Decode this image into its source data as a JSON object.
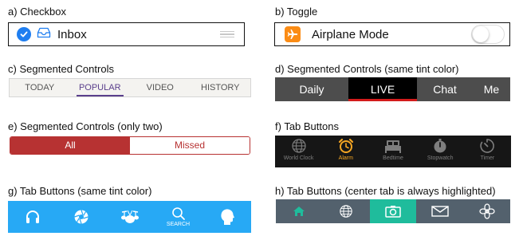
{
  "checkbox": {
    "title": "a) Checkbox",
    "label": "Inbox"
  },
  "toggle": {
    "title": "b) Toggle",
    "label": "Airplane Mode"
  },
  "segmented": {
    "title": "c) Segmented Controls",
    "items": [
      "TODAY",
      "POPULAR",
      "VIDEO",
      "HISTORY"
    ],
    "selected": "POPULAR"
  },
  "segmented_tint": {
    "title": "d) Segmented Controls (same tint color)",
    "items": [
      "Daily",
      "LIVE",
      "Chat",
      "Me"
    ],
    "selected": "LIVE"
  },
  "segmented_two": {
    "title": "e) Segmented Controls (only two)",
    "items": [
      "All",
      "Missed"
    ],
    "selected": "All"
  },
  "tab_buttons": {
    "title": "f) Tab Buttons",
    "items": [
      {
        "icon": "globe-icon",
        "label": "World Clock"
      },
      {
        "icon": "alarm-clock-icon",
        "label": "Alarm"
      },
      {
        "icon": "bed-icon",
        "label": "Bedtime"
      },
      {
        "icon": "stopwatch-icon",
        "label": "Stopwatch"
      },
      {
        "icon": "timer-icon",
        "label": "Timer"
      }
    ],
    "selected": "Alarm"
  },
  "tab_tint": {
    "title": "g) Tab Buttons (same tint color)",
    "items": [
      {
        "icon": "headphones-icon",
        "label": ""
      },
      {
        "icon": "aperture-icon",
        "label": ""
      },
      {
        "icon": "drums-icon",
        "label": ""
      },
      {
        "icon": "search-icon",
        "label": "SEARCH"
      },
      {
        "icon": "head-profile-icon",
        "label": ""
      }
    ]
  },
  "tab_center": {
    "title": "h) Tab Buttons (center tab is always highlighted)",
    "items": [
      {
        "icon": "home-icon"
      },
      {
        "icon": "globe-icon"
      },
      {
        "icon": "camera-icon"
      },
      {
        "icon": "mail-icon"
      },
      {
        "icon": "flower-icon"
      }
    ]
  },
  "colors": {
    "checkbox_blue": "#1f7ef0",
    "airplane_orange": "#fb8c15",
    "popular_purple": "#5a3f8c",
    "live_red": "#d31b1b",
    "missed_red": "#b73232",
    "alarm_orange": "#f5a623",
    "tint_blue": "#27a9f5",
    "center_green": "#1fbc9c"
  }
}
